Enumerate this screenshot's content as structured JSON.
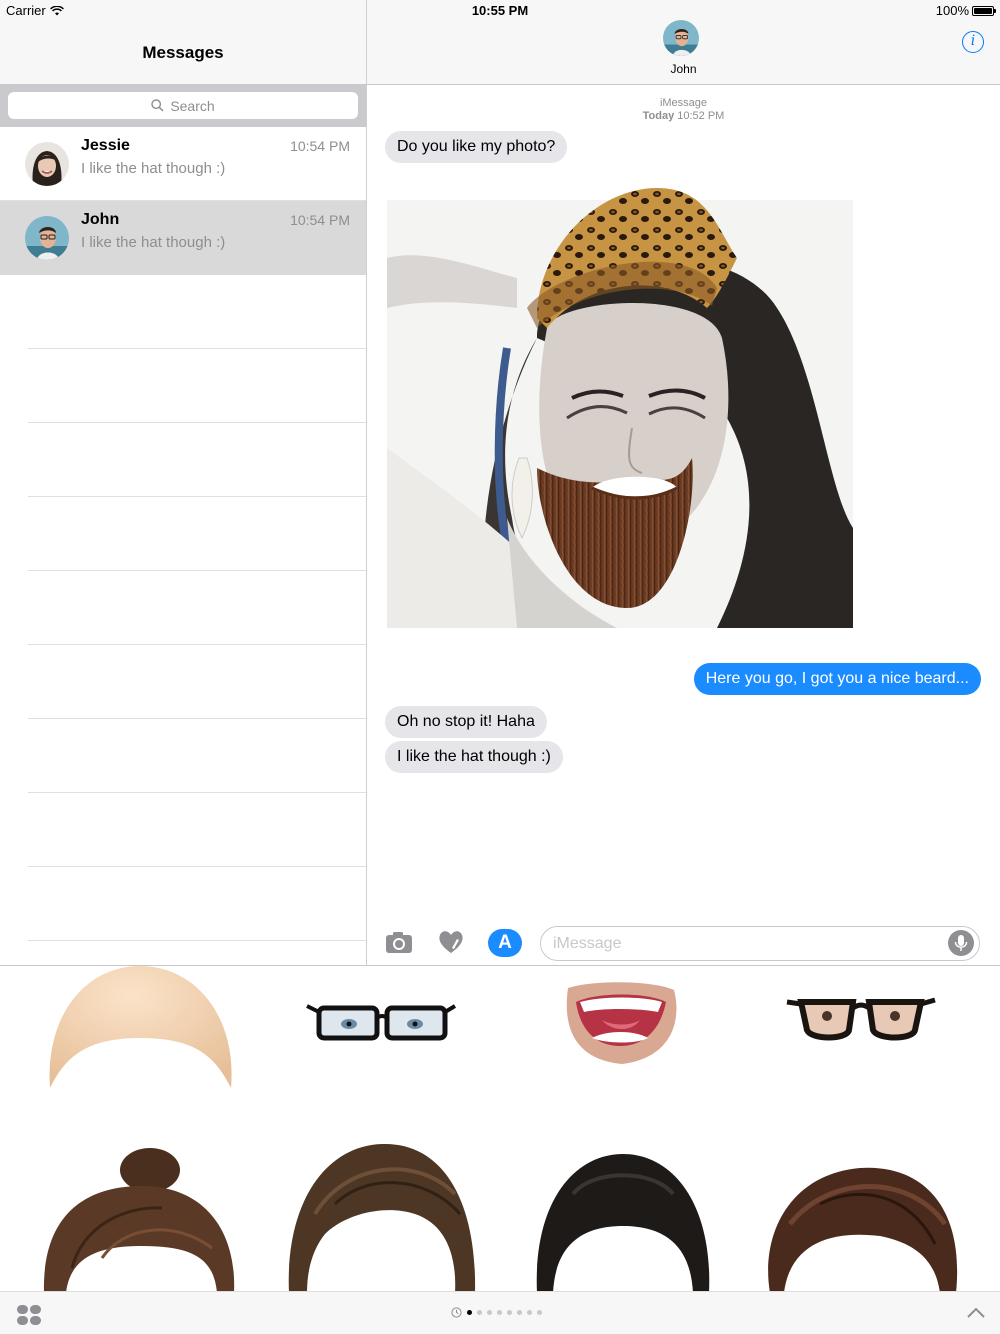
{
  "status_bar": {
    "carrier": "Carrier",
    "time": "10:55 PM",
    "battery": "100%"
  },
  "sidebar": {
    "title": "Messages",
    "search_placeholder": "Search",
    "conversations": [
      {
        "name": "Jessie",
        "preview": "I like the hat though :)",
        "time": "10:54 PM",
        "selected": false
      },
      {
        "name": "John",
        "preview": "I like the hat though :)",
        "time": "10:54 PM",
        "selected": true
      }
    ]
  },
  "conversation": {
    "contact_name": "John",
    "service": "iMessage",
    "timestamp_day": "Today",
    "timestamp_time": "10:52 PM",
    "messages": [
      {
        "direction": "in",
        "text": "Do you like my photo?"
      },
      {
        "direction": "in",
        "type": "photo"
      },
      {
        "direction": "out",
        "text": "Here you go, I got you a nice beard..."
      },
      {
        "direction": "in",
        "text": "Oh no stop it! Haha"
      },
      {
        "direction": "in",
        "text": "I like the hat though :)"
      }
    ]
  },
  "compose": {
    "placeholder": "iMessage",
    "app_store_glyph": "A"
  },
  "sticker_drawer": {
    "stickers": [
      "bald-cap",
      "rectangular-glasses",
      "smiling-mouth",
      "horn-rim-glasses",
      "hair-bun",
      "swept-hair",
      "buzz-cut-hair",
      "wavy-brown-hair"
    ],
    "page_count": 8,
    "active_page": 1
  },
  "colors": {
    "accent": "#007aff",
    "outgoing_bubble": "#1a8cff",
    "incoming_bubble": "#e5e5ea",
    "secondary_text": "#8e8e93"
  }
}
